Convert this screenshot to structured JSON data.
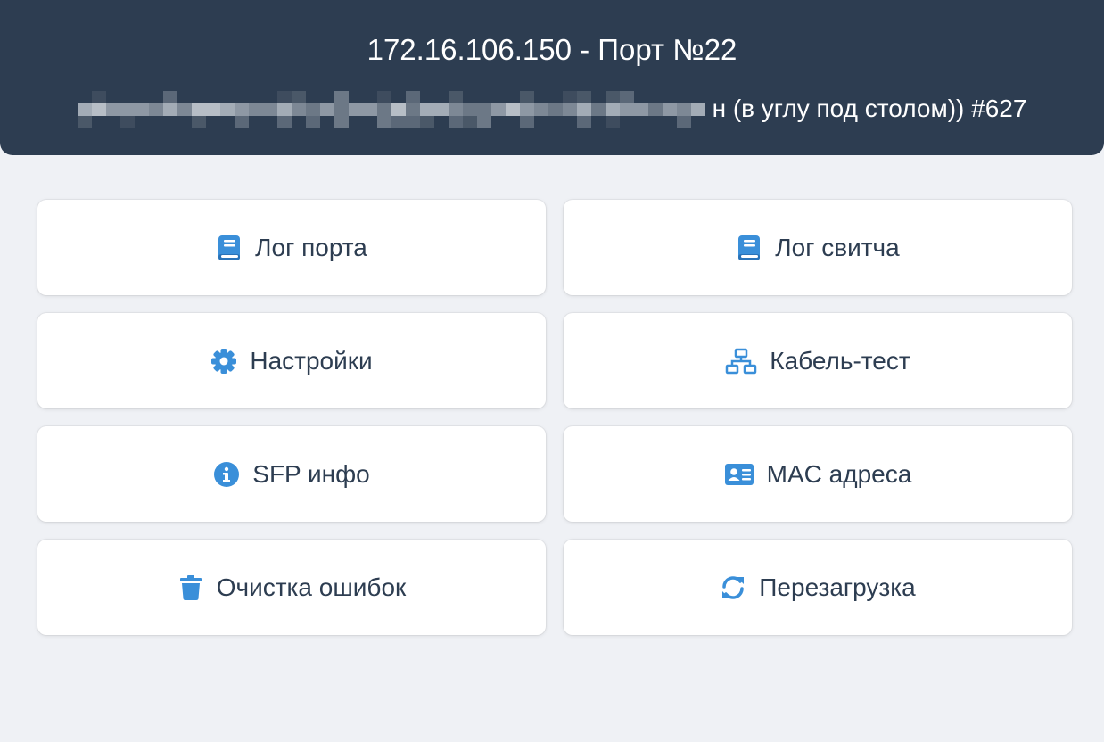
{
  "header": {
    "title": "172.16.106.150 - Порт №22",
    "subtitle_visible": "н (в углу под столом)) #627"
  },
  "colors": {
    "header_bg": "#2d3d51",
    "page_bg": "#eff1f5",
    "icon_accent": "#3a8fd9",
    "label_text": "#2d3d51"
  },
  "actions": [
    {
      "label": "Лог порта",
      "icon": "book-icon"
    },
    {
      "label": "Лог свитча",
      "icon": "book-icon"
    },
    {
      "label": "Настройки",
      "icon": "gear-icon"
    },
    {
      "label": "Кабель-тест",
      "icon": "network-icon"
    },
    {
      "label": "SFP инфо",
      "icon": "info-circle-icon"
    },
    {
      "label": "MAC адреса",
      "icon": "address-card-icon"
    },
    {
      "label": "Очистка ошибок",
      "icon": "trash-icon"
    },
    {
      "label": "Перезагрузка",
      "icon": "refresh-icon"
    }
  ]
}
